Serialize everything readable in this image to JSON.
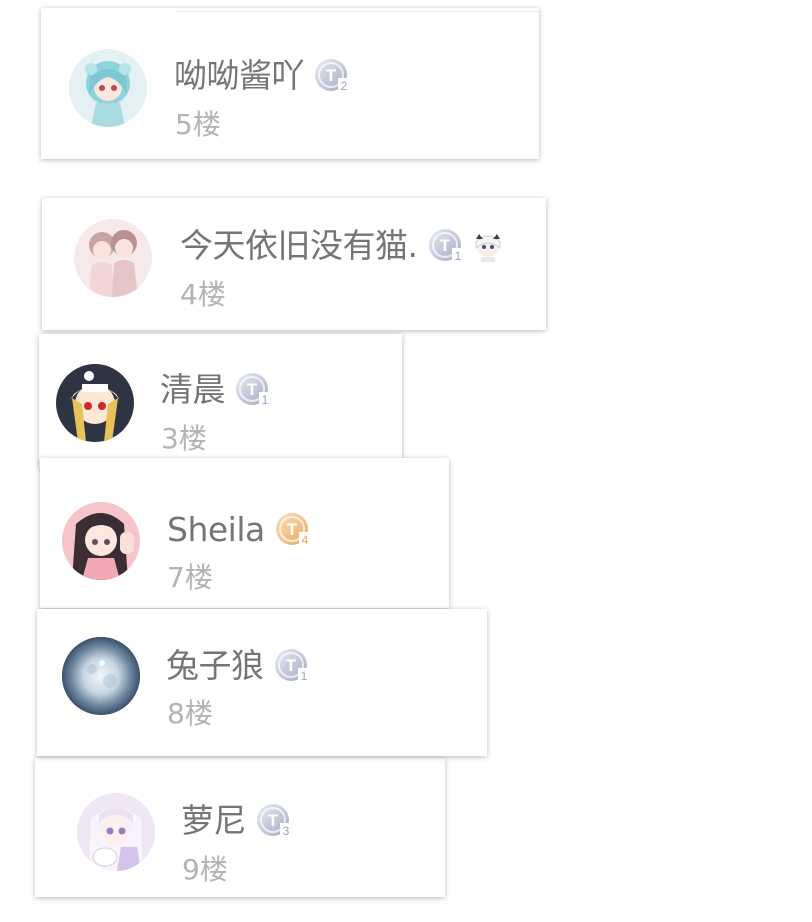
{
  "floors": [
    {
      "name": "呦呦酱吖",
      "floor": "5楼",
      "badge_level": "2",
      "badge_tier": "silver"
    },
    {
      "name": "今天依旧没有猫.",
      "floor": "4楼",
      "badge_level": "1",
      "badge_tier": "silver",
      "extra_icon": "paimon-emoji-icon"
    },
    {
      "name": "清晨",
      "floor": "3楼",
      "badge_level": "1",
      "badge_tier": "silver"
    },
    {
      "name": "Sheila",
      "floor": "7楼",
      "badge_level": "4",
      "badge_tier": "gold"
    },
    {
      "name": "兔子狼",
      "floor": "8楼",
      "badge_level": "1",
      "badge_tier": "silver"
    },
    {
      "name": "萝尼",
      "floor": "9楼",
      "badge_level": "3",
      "badge_tier": "silver"
    }
  ],
  "colors": {
    "name": "#757575",
    "floor": "#b3b3b3",
    "badge_silver": "#b9bdd1",
    "badge_gold": "#efb878"
  }
}
